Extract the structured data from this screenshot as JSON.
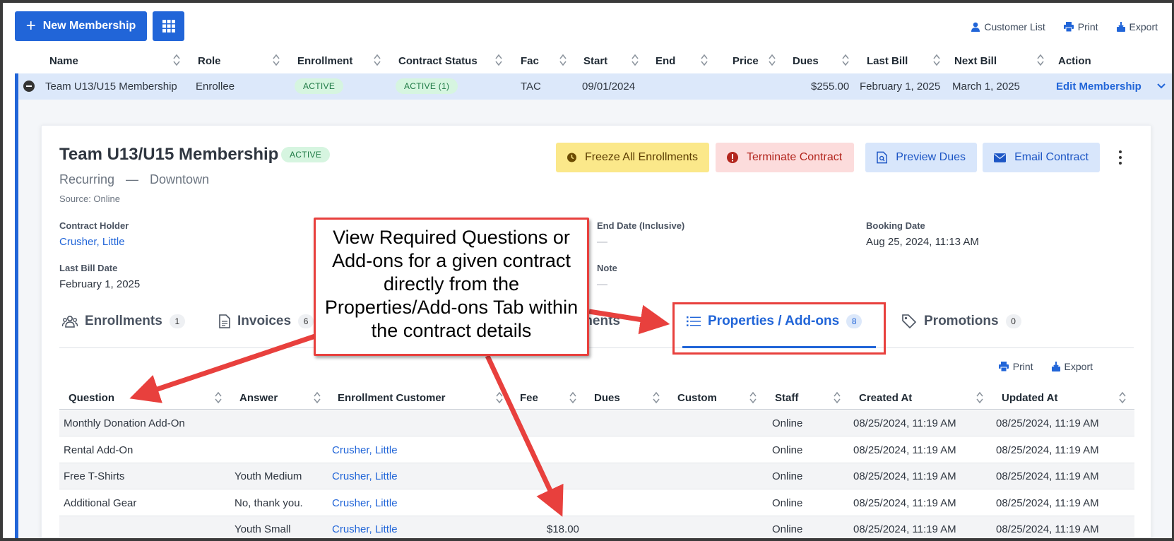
{
  "toolbar": {
    "new_membership_label": "New Membership",
    "links": [
      {
        "label": "Customer List",
        "icon": "person-icon"
      },
      {
        "label": "Print",
        "icon": "printer-icon"
      },
      {
        "label": "Export",
        "icon": "export-icon"
      }
    ]
  },
  "memberships_table": {
    "columns": [
      "Name",
      "Role",
      "Enrollment",
      "Contract Status",
      "Fac",
      "Start",
      "End",
      "Price",
      "Dues",
      "Last Bill",
      "Next Bill",
      "Action"
    ],
    "row": {
      "name": "Team U13/U15 Membership",
      "role": "Enrollee",
      "enrollment": "ACTIVE",
      "contract_status": "ACTIVE (1)",
      "fac": "TAC",
      "start": "09/01/2024",
      "end": "",
      "price": "",
      "dues": "$255.00",
      "last_bill": "February 1, 2025",
      "next_bill": "March 1, 2025",
      "action": "Edit Membership"
    }
  },
  "contract": {
    "title": "Team U13/U15 Membership",
    "status": "ACTIVE",
    "type": "Recurring",
    "separator": "—",
    "location": "Downtown",
    "source": "Source: Online",
    "buttons": {
      "freeze": "Freeze All Enrollments",
      "terminate": "Terminate Contract",
      "preview": "Preview Dues",
      "email": "Email Contract"
    },
    "fields": {
      "contract_holder_label": "Contract Holder",
      "contract_holder_value": "Crusher, Little",
      "last_bill_label": "Last Bill Date",
      "last_bill_value": "February 1, 2025",
      "end_date_label": "End Date (Inclusive)",
      "end_date_value": "—",
      "note_label": "Note",
      "note_value": "—",
      "booking_label": "Booking Date",
      "booking_value": "Aug 25, 2024, 11:13 AM"
    },
    "tabs": [
      {
        "label": "Enrollments",
        "count": "1",
        "icon": "people-icon"
      },
      {
        "label": "Invoices",
        "count": "6",
        "icon": "document-icon"
      },
      {
        "label": "ments",
        "count": "",
        "icon": ""
      },
      {
        "label": "Properties / Add-ons",
        "count": "8",
        "icon": "list-icon"
      },
      {
        "label": "Promotions",
        "count": "0",
        "icon": "tag-icon"
      }
    ],
    "sublinks": [
      {
        "label": "Print",
        "icon": "printer-icon"
      },
      {
        "label": "Export",
        "icon": "export-icon"
      }
    ]
  },
  "properties_table": {
    "columns": [
      "Question",
      "Answer",
      "Enrollment Customer",
      "Fee",
      "Dues",
      "Custom",
      "Staff",
      "Created At",
      "Updated At"
    ],
    "rows": [
      {
        "question": "Monthly Donation Add-On",
        "answer": "",
        "customer": "",
        "fee": "",
        "dues": "",
        "custom": "",
        "staff": "Online",
        "created": "08/25/2024, 11:19 AM",
        "updated": "08/25/2024, 11:19 AM"
      },
      {
        "question": "Rental Add-On",
        "answer": "",
        "customer": "Crusher, Little",
        "fee": "",
        "dues": "",
        "custom": "",
        "staff": "Online",
        "created": "08/25/2024, 11:19 AM",
        "updated": "08/25/2024, 11:19 AM"
      },
      {
        "question": "Free T-Shirts",
        "answer": "Youth Medium",
        "customer": "Crusher, Little",
        "fee": "",
        "dues": "",
        "custom": "",
        "staff": "Online",
        "created": "08/25/2024, 11:19 AM",
        "updated": "08/25/2024, 11:19 AM"
      },
      {
        "question": "Additional Gear",
        "answer": "No, thank you.",
        "customer": "Crusher, Little",
        "fee": "",
        "dues": "",
        "custom": "",
        "staff": "Online",
        "created": "08/25/2024, 11:19 AM",
        "updated": "08/25/2024, 11:19 AM"
      },
      {
        "question": "",
        "answer": "Youth Small",
        "customer": "Crusher, Little",
        "fee": "$18.00",
        "dues": "",
        "custom": "",
        "staff": "Online",
        "created": "08/25/2024, 11:19 AM",
        "updated": "08/25/2024, 11:19 AM"
      }
    ]
  },
  "annotation": {
    "text": "View Required Questions or Add-ons for a given contract directly from the Properties/Add-ons Tab within the contract details",
    "color": "#e8403d"
  },
  "colors": {
    "primary": "#2165d8",
    "active_green": "#1f7a45",
    "freeze_yellow": "#fbe88a",
    "terminate_red": "#fcdcdc",
    "row_highlight": "#dce8fa"
  }
}
